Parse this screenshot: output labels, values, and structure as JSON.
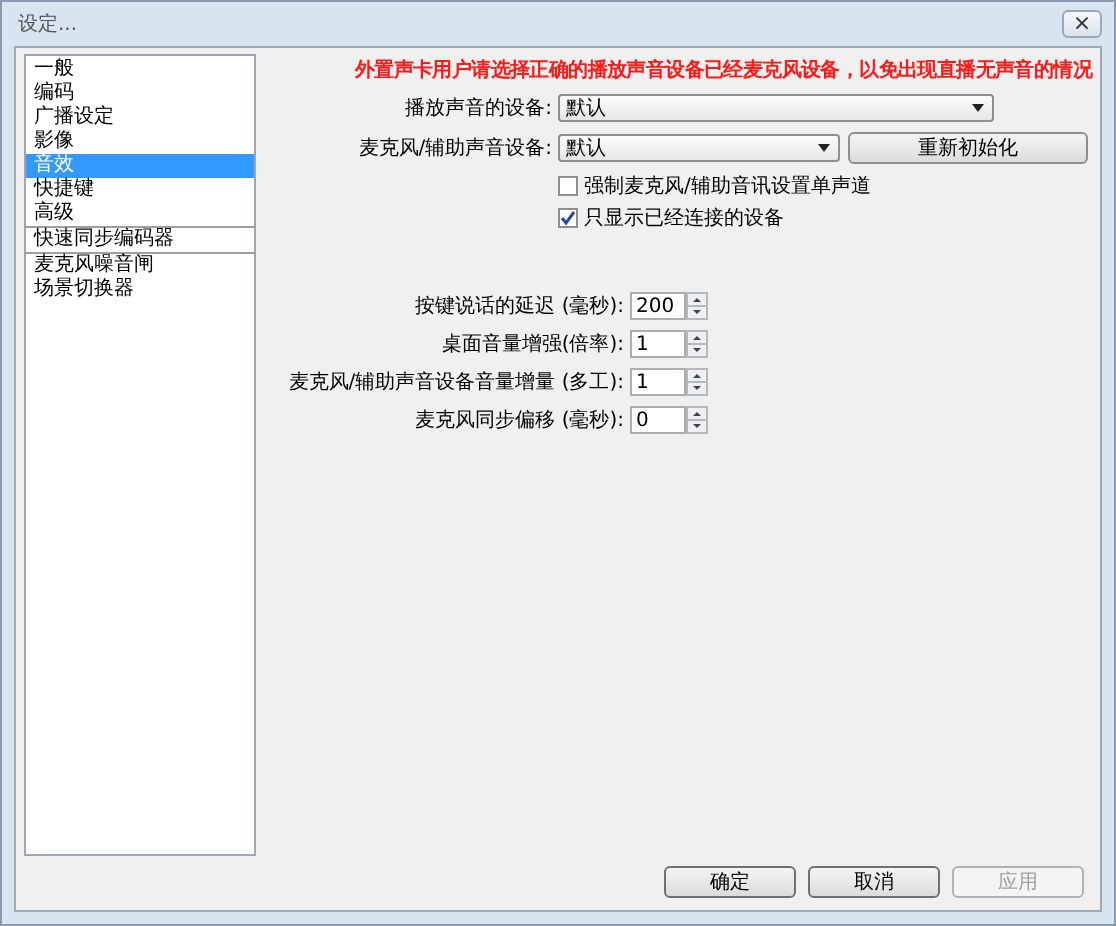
{
  "window": {
    "title": "设定...",
    "close": "×"
  },
  "sidebar": {
    "items": [
      {
        "label": "一般",
        "selected": false,
        "separator_after": false
      },
      {
        "label": "编码",
        "selected": false,
        "separator_after": false
      },
      {
        "label": "广播设定",
        "selected": false,
        "separator_after": false
      },
      {
        "label": "影像",
        "selected": false,
        "separator_after": false
      },
      {
        "label": "音效",
        "selected": true,
        "separator_after": false
      },
      {
        "label": "快捷键",
        "selected": false,
        "separator_after": false
      },
      {
        "label": "高级",
        "selected": false,
        "separator_after": true
      },
      {
        "label": "快速同步编码器",
        "selected": false,
        "separator_after": true
      },
      {
        "label": "麦克风噪音闸",
        "selected": false,
        "separator_after": false
      },
      {
        "label": "场景切换器",
        "selected": false,
        "separator_after": false
      }
    ]
  },
  "warning": "外置声卡用户请选择正确的播放声音设备已经麦克风设备，以免出现直播无声音的情况",
  "devices": [
    {
      "label": "播放声音的设备:",
      "value": "默认"
    },
    {
      "label": "麦克风/辅助声音设备:",
      "value": "默认",
      "button": "重新初始化"
    }
  ],
  "checkboxes": [
    {
      "label": "强制麦克风/辅助音讯设置单声道",
      "checked": false
    },
    {
      "label": "只显示已经连接的设备",
      "checked": true
    }
  ],
  "spinners": [
    {
      "label": "按键说话的延迟 (毫秒):",
      "value": "200"
    },
    {
      "label": "桌面音量增强(倍率):",
      "value": "1"
    },
    {
      "label": "麦克风/辅助声音设备音量增量 (多工):",
      "value": "1"
    },
    {
      "label": "麦克风同步偏移 (毫秒):",
      "value": "0"
    }
  ],
  "buttons": [
    {
      "label": "确定",
      "disabled": false
    },
    {
      "label": "取消",
      "disabled": false
    },
    {
      "label": "应用",
      "disabled": true
    }
  ]
}
